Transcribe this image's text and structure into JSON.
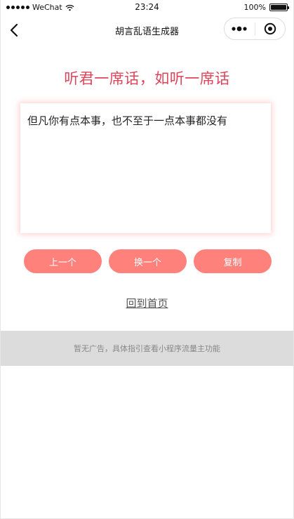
{
  "status_bar": {
    "carrier": "WeChat",
    "time": "23:24",
    "battery_text": "100%",
    "battery_level": 1.0
  },
  "nav": {
    "title": "胡言乱语生成器",
    "back_icon": "chevron-left-icon",
    "menu_icon": "more-dots-icon",
    "close_icon": "target-close-icon"
  },
  "heading": "听君一席话，如听一席话",
  "generated_text": "但凡你有点本事，也不至于一点本事都没有",
  "buttons": {
    "prev": "上一个",
    "next": "换一个",
    "copy": "复制"
  },
  "home_link": "回到首页",
  "ad_text": "暂无广告，具体指引查看小程序流量主功能",
  "colors": {
    "accent": "#e0445a",
    "button": "#ff817c",
    "ad_bg": "#dcdcdc"
  }
}
